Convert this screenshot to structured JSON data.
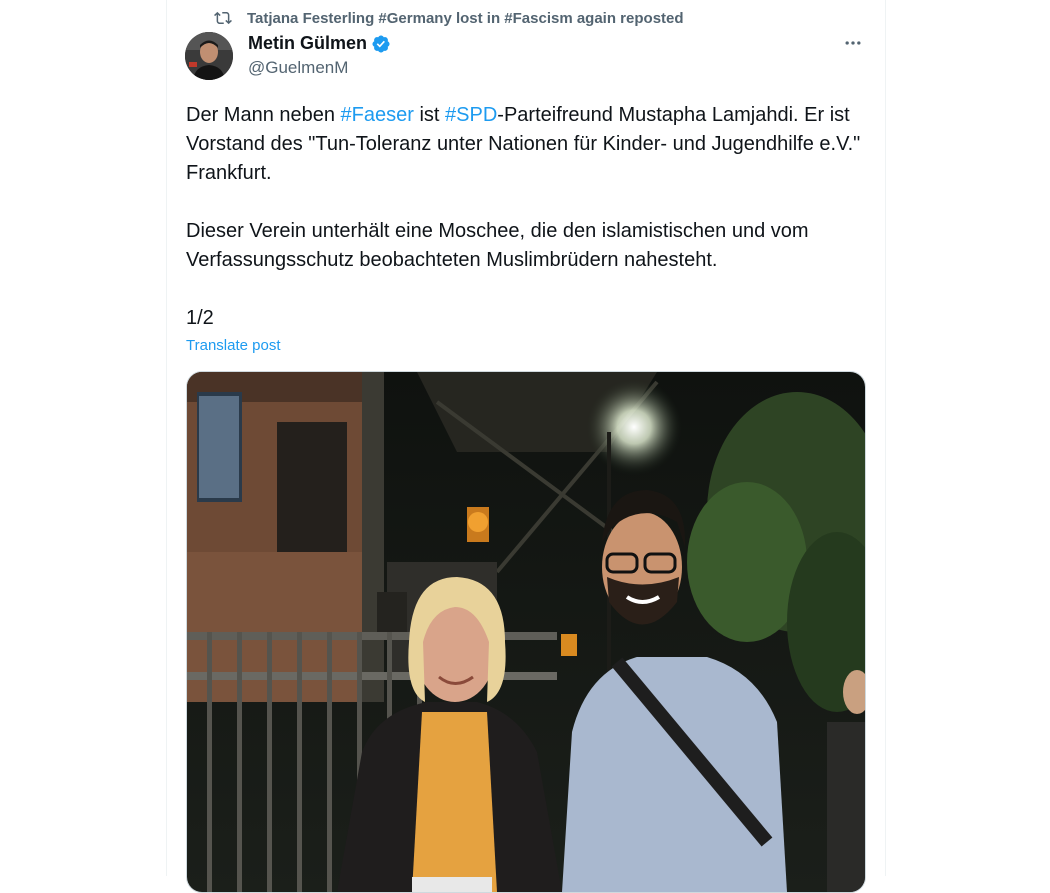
{
  "repost": {
    "text": "Tatjana Festerling #Germany lost in #Fascism again reposted",
    "icon": "repost-icon"
  },
  "author": {
    "name": "Metin Gülmen",
    "handle": "@GuelmenM",
    "verified": true,
    "verified_color": "#1d9bf0"
  },
  "tweet": {
    "p1_a": "Der Mann neben ",
    "p1_tag1": "#Faeser",
    "p1_b": " ist ",
    "p1_tag2": "#SPD",
    "p1_c": "-Parteifreund Mustapha Lamjahdi. Er ist Vorstand des \"Tun-Toleranz unter Nationen für Kinder- und Jugendhilfe e.V.\" Frankfurt.",
    "p2": "Dieser Verein unterhält eine Moschee, die den islamistischen und vom Verfassungsschutz beobachteten Muslimbrüdern nahesteht.",
    "p3": "1/2"
  },
  "translate_label": "Translate post",
  "colors": {
    "link": "#1d9bf0",
    "secondary_text": "#536471",
    "primary_text": "#0f1419"
  }
}
